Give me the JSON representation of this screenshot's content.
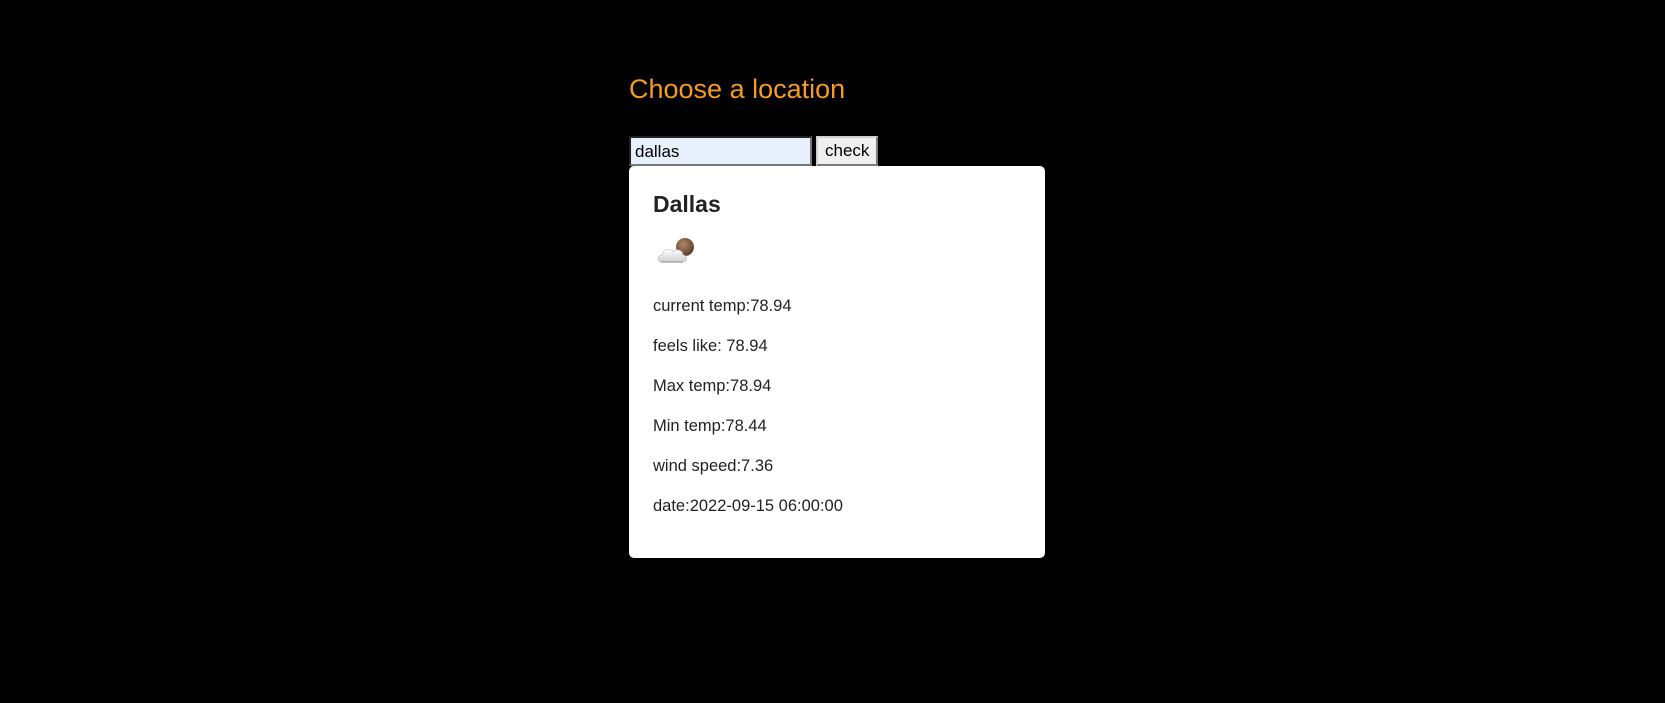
{
  "header": {
    "title": "Choose a location"
  },
  "search": {
    "value": "dallas",
    "button_label": "check"
  },
  "weather": {
    "city": "Dallas",
    "icon": "partly-cloudy-night-icon",
    "current_temp": "current temp:78.94",
    "feels_like": "feels like: 78.94",
    "max_temp": "Max temp:78.94",
    "min_temp": "Min temp:78.44",
    "wind_speed": "wind speed:7.36",
    "date": "date:2022-09-15 06:00:00"
  },
  "colors": {
    "background": "#000000",
    "heading": "#f59a23",
    "card": "#ffffff",
    "input_autofill": "#e8f0fe"
  }
}
